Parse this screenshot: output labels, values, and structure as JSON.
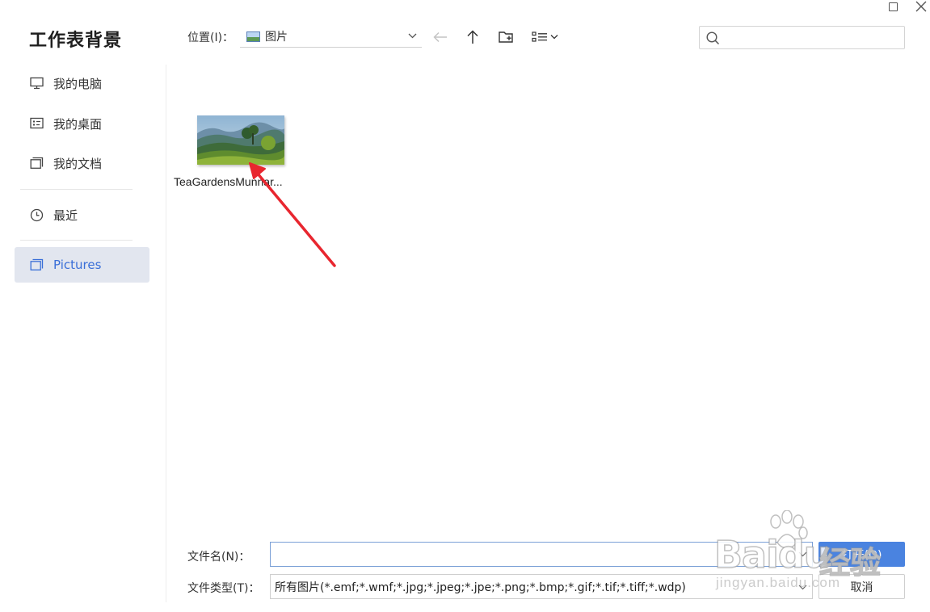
{
  "dialog": {
    "title": "工作表背景"
  },
  "sidebar": {
    "items": [
      {
        "label": "我的电脑",
        "icon": "monitor-icon"
      },
      {
        "label": "我的桌面",
        "icon": "desktop-icon"
      },
      {
        "label": "我的文档",
        "icon": "documents-icon"
      },
      {
        "label": "最近",
        "icon": "clock-icon"
      },
      {
        "label": "Pictures",
        "icon": "folder-icon",
        "active": true
      }
    ]
  },
  "toolbar": {
    "location_label": "位置(I)：",
    "location_value": "图片",
    "icons": [
      "back-arrow-icon",
      "up-arrow-icon",
      "new-folder-icon",
      "view-mode-icon"
    ],
    "search_placeholder": ""
  },
  "files": [
    {
      "name": "TeaGardensMunnar...",
      "icon": "image-thumbnail"
    }
  ],
  "footer": {
    "filename_label": "文件名(N)：",
    "filename_value": "",
    "filetype_label": "文件类型(T)：",
    "filetype_value": "所有图片(*.emf;*.wmf;*.jpg;*.jpeg;*.jpe;*.png;*.bmp;*.gif;*.tif;*.tiff;*.wdp)",
    "open_label": "打开(O)",
    "cancel_label": "取消"
  },
  "watermark": {
    "brand": "Baidu",
    "brand_cn": "经验",
    "url": "jingyan.baidu.com"
  },
  "colors": {
    "accent": "#4a83e0",
    "sidebar_active_bg": "#e2e6ef",
    "sidebar_active_text": "#3a6fd8",
    "annotation_arrow": "#e8262f"
  }
}
